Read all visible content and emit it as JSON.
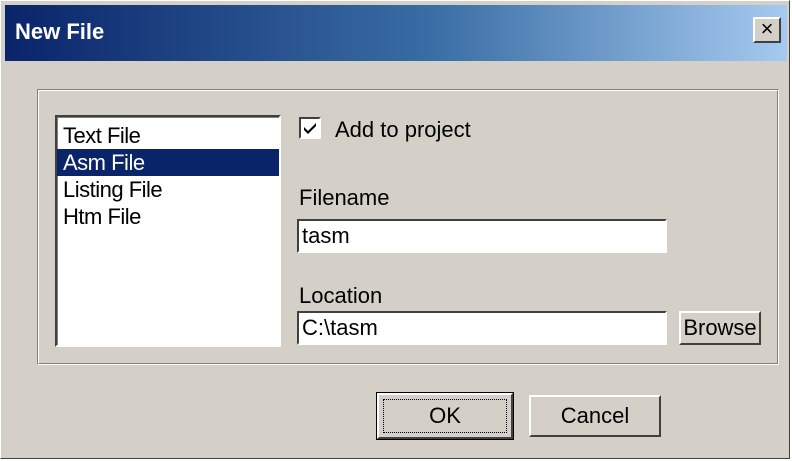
{
  "window": {
    "title": "New File",
    "close_label": "×"
  },
  "file_types": {
    "items": [
      "Text File",
      "Asm File",
      "Listing File",
      "Htm File"
    ],
    "selected": "Asm File"
  },
  "add_to_project": {
    "label": "Add to project",
    "checked": true
  },
  "filename": {
    "label": "Filename",
    "value": "tasm"
  },
  "location": {
    "label": "Location",
    "value": "C:\\tasm",
    "browse_label": "Browse"
  },
  "buttons": {
    "ok_label": "OK",
    "cancel_label": "Cancel"
  },
  "colors": {
    "title_bar": "#0a246a",
    "selection": "#0a246a",
    "face": "#d4d0c8"
  }
}
